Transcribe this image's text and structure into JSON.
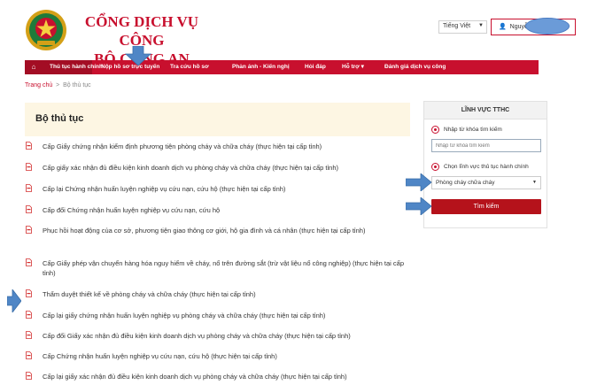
{
  "header": {
    "title_line1": "CỔNG DỊCH VỤ CÔNG",
    "title_line2": "BỘ CÔNG AN",
    "language": "Tiếng Việt",
    "user_label": "Nguyễn"
  },
  "nav": {
    "items": [
      {
        "label": "Thủ tục hành chính",
        "active": true
      },
      {
        "label": "Nộp hồ sơ trực tuyến"
      },
      {
        "label": "Tra cứu hồ sơ"
      },
      {
        "label": "Phản ánh - Kiến nghị"
      },
      {
        "label": "Hỏi đáp"
      },
      {
        "label": "Hỗ trợ ▾"
      },
      {
        "label": "Đánh giá dịch vụ công"
      }
    ]
  },
  "breadcrumb": {
    "home": "Trang chủ",
    "sep": ">",
    "current": "Bộ thủ tục"
  },
  "main": {
    "title": "Bộ thủ tục",
    "procedures": [
      "Cấp Giấy chứng nhận kiểm định phương tiện phòng cháy và chữa cháy (thực hiện tại cấp tỉnh)",
      "Cấp giấy xác nhận đủ điều kiện kinh doanh dịch vụ phòng cháy và chữa cháy (thực hiện tại cấp tỉnh)",
      "Cấp lại Chứng nhận huấn luyện nghiệp vụ cứu nạn, cứu hộ (thực hiện tại cấp tỉnh)",
      "Cấp đổi Chứng nhận huấn luyện nghiệp vụ cứu nạn, cứu hộ",
      "Phục hồi hoạt động của cơ sở, phương tiện giao thông cơ giới, hộ gia đình và cá nhân (thực hiện tại cấp tỉnh)",
      "Cấp Giấy phép vận chuyển hàng hóa nguy hiểm về cháy, nổ trên đường sắt (trừ vật liệu nổ công nghiệp) (thực hiện tại cấp tỉnh)",
      "Thẩm duyệt thiết kế về phòng cháy và chữa cháy (thực hiện tại cấp tỉnh)",
      "Cấp lại giấy chứng nhận huấn luyện nghiệp vụ phòng cháy và chữa cháy (thực hiện tại cấp tỉnh)",
      "Cấp đổi Giấy xác nhận đủ điều kiện kinh doanh dịch vụ phòng cháy và chữa cháy (thực hiện tại cấp tỉnh)",
      "Cấp Chứng nhận huấn luyện nghiệp vụ cứu nạn, cứu hộ (thực hiện tại cấp tỉnh)",
      "Cấp lại giấy xác nhận đủ điều kiện kinh doanh dịch vụ phòng cháy và chữa cháy (thực hiện tại cấp tỉnh)"
    ]
  },
  "sidebar": {
    "title": "LĨNH VỰC TTHC",
    "option_keyword": "Nhập từ khóa tìm kiếm",
    "keyword_placeholder": "Nhập từ khóa tìm kiếm",
    "option_field": "Chọn lĩnh vực thủ tục hành chính",
    "selected_field": "Phòng cháy chữa cháy",
    "search_button": "Tìm kiếm"
  },
  "colors": {
    "brand_red": "#c8102e",
    "panel_bg": "#fdf6e3",
    "annotation_blue": "#4f86c6"
  }
}
